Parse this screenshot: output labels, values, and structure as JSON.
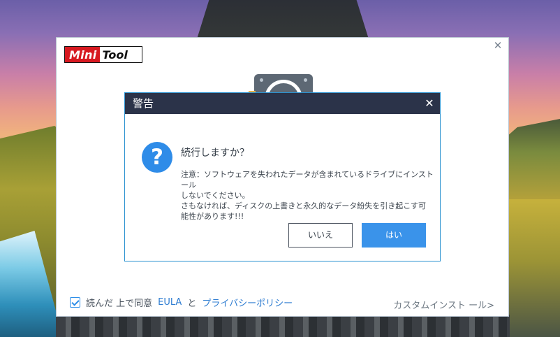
{
  "installer": {
    "logo": {
      "mini": "Mini",
      "tool": "Tool"
    },
    "close_glyph": "✕",
    "eula_prefix": "読んだ 上で同意 ",
    "eula_link": "EULA",
    "eula_and": " と ",
    "privacy_link": "プライバシーポリシー",
    "eula_checked": true,
    "custom_install": "カスタムインスト ール>"
  },
  "modal": {
    "title": "警告",
    "close_glyph": "✕",
    "icon_glyph": "?",
    "question": "続行しますか？",
    "body_lines": [
      "注意：ソフトウェアを失われたデータが含まれているドライブにインストール",
      "しないでください。",
      "さもなければ、ディスクの上書きと永久的なデータ紛失を引き起こす可",
      "能性があります!!!"
    ],
    "no_button": "いいえ",
    "yes_button": "はい"
  },
  "colors": {
    "modal_header": "#2b3349",
    "accent": "#3a93ea",
    "logo_red": "#d71920"
  }
}
